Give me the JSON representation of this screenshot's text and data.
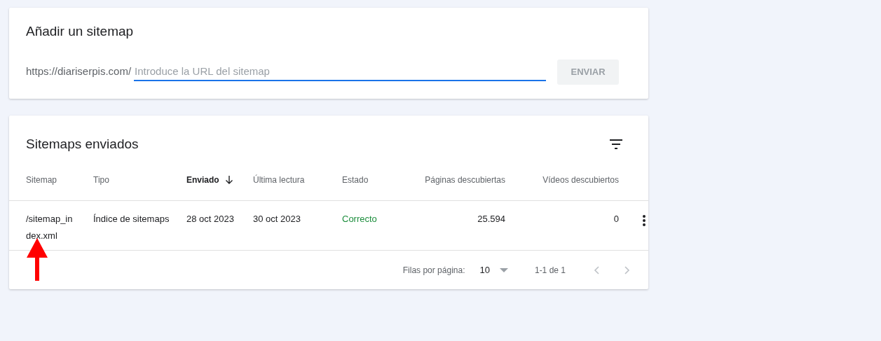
{
  "add_sitemap": {
    "title": "Añadir un sitemap",
    "prefix": "https://diariserpis.com/",
    "placeholder": "Introduce la URL del sitemap",
    "button": {
      "label": "ENVIAR",
      "disabled": true
    }
  },
  "submitted": {
    "title": "Sitemaps enviados",
    "columns": [
      {
        "label": "Sitemap",
        "kind": "text",
        "sorted": false
      },
      {
        "label": "Tipo",
        "kind": "text",
        "sorted": false
      },
      {
        "label": "Enviado",
        "kind": "text",
        "sorted": true
      },
      {
        "label": "Última lectura",
        "kind": "text",
        "sorted": false
      },
      {
        "label": "Estado",
        "kind": "status",
        "sorted": false
      },
      {
        "label": "Páginas descubiertas",
        "kind": "count",
        "sorted": false
      },
      {
        "label": "Vídeos descubiertos",
        "kind": "count",
        "sorted": false
      }
    ],
    "rows": [
      {
        "cells": [
          "/sitemap_index.xml",
          "Índice de sitemaps",
          "28 oct 2023",
          "30 oct 2023",
          "Correcto",
          "25.594",
          "0"
        ],
        "color": "#1e8e3e"
      }
    ],
    "pagination": {
      "rows_label": "Filas por página:",
      "rows_value": "10",
      "range": "1-1 de 1",
      "prev_disabled": true,
      "next_disabled": true
    }
  }
}
